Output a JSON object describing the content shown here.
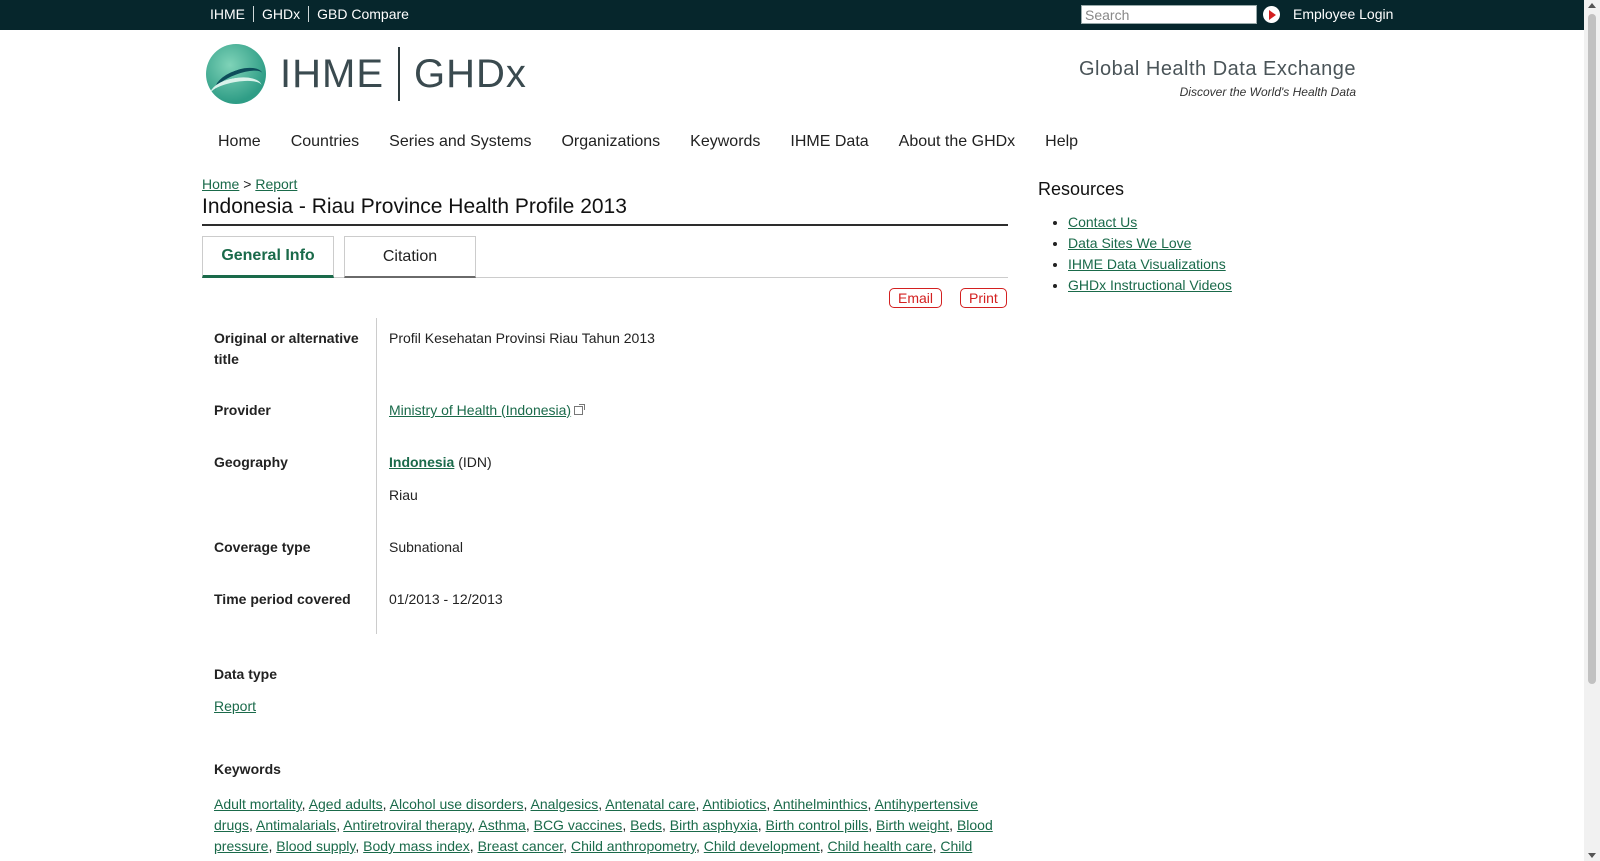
{
  "topbar": {
    "links": [
      "IHME",
      "GHDx",
      "GBD Compare"
    ],
    "search_placeholder": "Search",
    "employee_login": "Employee Login"
  },
  "header": {
    "logo_left": "IHME",
    "logo_right": "GHDx",
    "tagline": "Global Health Data Exchange",
    "subtagline": "Discover the World's Health Data"
  },
  "nav": [
    "Home",
    "Countries",
    "Series and Systems",
    "Organizations",
    "Keywords",
    "IHME Data",
    "About the GHDx",
    "Help"
  ],
  "breadcrumb": {
    "home": "Home",
    "sep": ">",
    "current": "Report"
  },
  "page": {
    "title": "Indonesia - Riau Province Health Profile 2013"
  },
  "tabs": [
    "General Info",
    "Citation"
  ],
  "actions": {
    "email": "Email",
    "print": "Print"
  },
  "details": {
    "original_title_label": "Original or alternative title",
    "original_title_value": "Profil Kesehatan Provinsi Riau Tahun 2013",
    "provider_label": "Provider",
    "provider_value": "Ministry of Health (Indonesia)",
    "geography_label": "Geography",
    "geography_country": "Indonesia",
    "geography_code": "(IDN)",
    "geography_region": "Riau",
    "coverage_label": "Coverage type",
    "coverage_value": "Subnational",
    "time_label": "Time period covered",
    "time_value": "01/2013 - 12/2013"
  },
  "data_type": {
    "label": "Data type",
    "value": "Report"
  },
  "keywords": {
    "label": "Keywords",
    "items": [
      "Adult mortality",
      "Aged adults",
      "Alcohol use disorders",
      "Analgesics",
      "Antenatal care",
      "Antibiotics",
      "Antihelminthics",
      "Antihypertensive drugs",
      "Antimalarials",
      "Antiretroviral therapy",
      "Asthma",
      "BCG vaccines",
      "Beds",
      "Birth asphyxia",
      "Birth control pills",
      "Birth weight",
      "Blood pressure",
      "Blood supply",
      "Body mass index",
      "Breast cancer",
      "Child anthropometry",
      "Child development",
      "Child health care",
      "Child"
    ]
  },
  "resources": {
    "title": "Resources",
    "items": [
      "Contact Us",
      "Data Sites We Love",
      "IHME Data Visualizations",
      "GHDx Instructional Videos"
    ]
  },
  "colors": {
    "topbar": "#06262c",
    "link": "#1a6a4a",
    "action_red": "#d32020"
  }
}
